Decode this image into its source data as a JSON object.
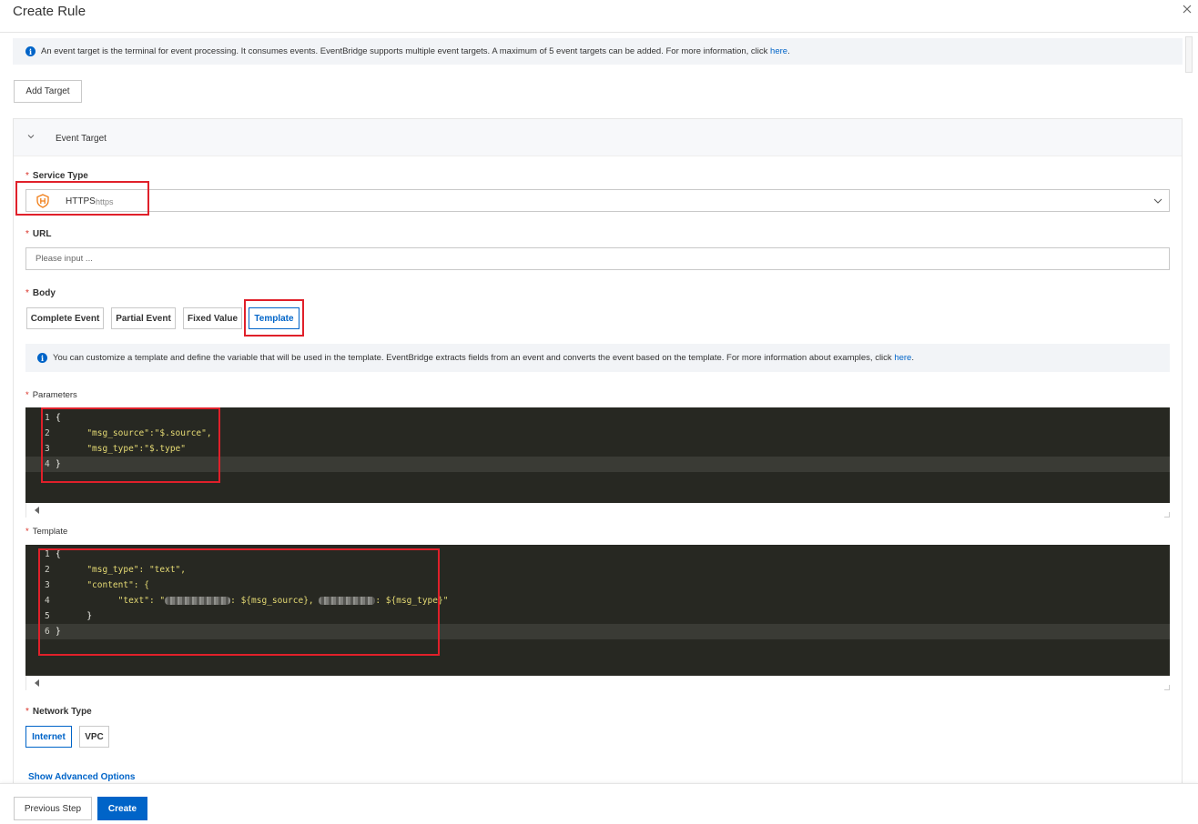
{
  "header": {
    "title": "Create Rule",
    "close_icon": "close-icon"
  },
  "info_top": {
    "text": "An event target is the terminal for event processing. It consumes events. EventBridge supports multiple event targets. A maximum of 5 event targets can be added. For more information, click ",
    "link": "here",
    "suffix": "."
  },
  "add_target_label": "Add Target",
  "event_target": {
    "title": "Event Target",
    "service_type": {
      "label": "Service Type",
      "icon": "https-service-icon",
      "value": "HTTPS",
      "sub": "https"
    },
    "url": {
      "label": "URL",
      "placeholder": "Please input ..."
    },
    "body": {
      "label": "Body",
      "options": [
        "Complete Event",
        "Partial Event",
        "Fixed Value",
        "Template"
      ],
      "selected": "Template"
    },
    "template_info": {
      "text": "You can customize a template and define the variable that will be used in the template. EventBridge extracts fields from an event and converts the event based on the template. For more information about examples, click ",
      "link": "here",
      "suffix": "."
    },
    "parameters": {
      "label": "Parameters",
      "lines": [
        {
          "n": "1",
          "pre": "{",
          "str": "",
          "post": ""
        },
        {
          "n": "2",
          "pre": "      ",
          "str": "\"msg_source\":\"$.source\",",
          "post": ""
        },
        {
          "n": "3",
          "pre": "      ",
          "str": "\"msg_type\":\"$.type\"",
          "post": ""
        },
        {
          "n": "4",
          "pre": "}",
          "str": "",
          "post": ""
        }
      ]
    },
    "template": {
      "label": "Template",
      "lines": [
        {
          "n": "1",
          "pre": "{",
          "str": "",
          "post": ""
        },
        {
          "n": "2",
          "pre": "      ",
          "str": "\"msg_type\": \"text\",",
          "post": ""
        },
        {
          "n": "3",
          "pre": "      ",
          "str": "\"content\": {",
          "post": ""
        },
        {
          "n": "4",
          "pre": "            ",
          "str": "\"text\": \"",
          "post": "",
          "blur": true,
          "mid": ": ${msg_source}, ",
          "tail": ": ${msg_type}\""
        },
        {
          "n": "5",
          "pre": "      }",
          "str": "",
          "post": ""
        },
        {
          "n": "6",
          "pre": "}",
          "str": "",
          "post": ""
        }
      ]
    },
    "network_type": {
      "label": "Network Type",
      "options": [
        "Internet",
        "VPC"
      ],
      "selected": "Internet"
    },
    "advanced_link": "Show Advanced Options"
  },
  "footer": {
    "previous_label": "Previous Step",
    "create_label": "Create"
  },
  "colors": {
    "primary": "#0064c8",
    "highlight": "#e0202a",
    "editor_bg": "#272822",
    "string": "#e6db74"
  }
}
